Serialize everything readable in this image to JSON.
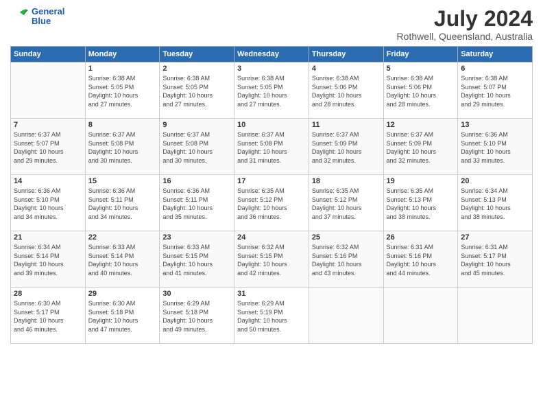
{
  "header": {
    "logo_line1": "General",
    "logo_line2": "Blue",
    "month_year": "July 2024",
    "location": "Rothwell, Queensland, Australia"
  },
  "days_of_week": [
    "Sunday",
    "Monday",
    "Tuesday",
    "Wednesday",
    "Thursday",
    "Friday",
    "Saturday"
  ],
  "weeks": [
    [
      {
        "num": "",
        "info": ""
      },
      {
        "num": "1",
        "info": "Sunrise: 6:38 AM\nSunset: 5:05 PM\nDaylight: 10 hours\nand 27 minutes."
      },
      {
        "num": "2",
        "info": "Sunrise: 6:38 AM\nSunset: 5:05 PM\nDaylight: 10 hours\nand 27 minutes."
      },
      {
        "num": "3",
        "info": "Sunrise: 6:38 AM\nSunset: 5:05 PM\nDaylight: 10 hours\nand 27 minutes."
      },
      {
        "num": "4",
        "info": "Sunrise: 6:38 AM\nSunset: 5:06 PM\nDaylight: 10 hours\nand 28 minutes."
      },
      {
        "num": "5",
        "info": "Sunrise: 6:38 AM\nSunset: 5:06 PM\nDaylight: 10 hours\nand 28 minutes."
      },
      {
        "num": "6",
        "info": "Sunrise: 6:38 AM\nSunset: 5:07 PM\nDaylight: 10 hours\nand 29 minutes."
      }
    ],
    [
      {
        "num": "7",
        "info": "Sunrise: 6:37 AM\nSunset: 5:07 PM\nDaylight: 10 hours\nand 29 minutes."
      },
      {
        "num": "8",
        "info": "Sunrise: 6:37 AM\nSunset: 5:08 PM\nDaylight: 10 hours\nand 30 minutes."
      },
      {
        "num": "9",
        "info": "Sunrise: 6:37 AM\nSunset: 5:08 PM\nDaylight: 10 hours\nand 30 minutes."
      },
      {
        "num": "10",
        "info": "Sunrise: 6:37 AM\nSunset: 5:08 PM\nDaylight: 10 hours\nand 31 minutes."
      },
      {
        "num": "11",
        "info": "Sunrise: 6:37 AM\nSunset: 5:09 PM\nDaylight: 10 hours\nand 32 minutes."
      },
      {
        "num": "12",
        "info": "Sunrise: 6:37 AM\nSunset: 5:09 PM\nDaylight: 10 hours\nand 32 minutes."
      },
      {
        "num": "13",
        "info": "Sunrise: 6:36 AM\nSunset: 5:10 PM\nDaylight: 10 hours\nand 33 minutes."
      }
    ],
    [
      {
        "num": "14",
        "info": "Sunrise: 6:36 AM\nSunset: 5:10 PM\nDaylight: 10 hours\nand 34 minutes."
      },
      {
        "num": "15",
        "info": "Sunrise: 6:36 AM\nSunset: 5:11 PM\nDaylight: 10 hours\nand 34 minutes."
      },
      {
        "num": "16",
        "info": "Sunrise: 6:36 AM\nSunset: 5:11 PM\nDaylight: 10 hours\nand 35 minutes."
      },
      {
        "num": "17",
        "info": "Sunrise: 6:35 AM\nSunset: 5:12 PM\nDaylight: 10 hours\nand 36 minutes."
      },
      {
        "num": "18",
        "info": "Sunrise: 6:35 AM\nSunset: 5:12 PM\nDaylight: 10 hours\nand 37 minutes."
      },
      {
        "num": "19",
        "info": "Sunrise: 6:35 AM\nSunset: 5:13 PM\nDaylight: 10 hours\nand 38 minutes."
      },
      {
        "num": "20",
        "info": "Sunrise: 6:34 AM\nSunset: 5:13 PM\nDaylight: 10 hours\nand 38 minutes."
      }
    ],
    [
      {
        "num": "21",
        "info": "Sunrise: 6:34 AM\nSunset: 5:14 PM\nDaylight: 10 hours\nand 39 minutes."
      },
      {
        "num": "22",
        "info": "Sunrise: 6:33 AM\nSunset: 5:14 PM\nDaylight: 10 hours\nand 40 minutes."
      },
      {
        "num": "23",
        "info": "Sunrise: 6:33 AM\nSunset: 5:15 PM\nDaylight: 10 hours\nand 41 minutes."
      },
      {
        "num": "24",
        "info": "Sunrise: 6:32 AM\nSunset: 5:15 PM\nDaylight: 10 hours\nand 42 minutes."
      },
      {
        "num": "25",
        "info": "Sunrise: 6:32 AM\nSunset: 5:16 PM\nDaylight: 10 hours\nand 43 minutes."
      },
      {
        "num": "26",
        "info": "Sunrise: 6:31 AM\nSunset: 5:16 PM\nDaylight: 10 hours\nand 44 minutes."
      },
      {
        "num": "27",
        "info": "Sunrise: 6:31 AM\nSunset: 5:17 PM\nDaylight: 10 hours\nand 45 minutes."
      }
    ],
    [
      {
        "num": "28",
        "info": "Sunrise: 6:30 AM\nSunset: 5:17 PM\nDaylight: 10 hours\nand 46 minutes."
      },
      {
        "num": "29",
        "info": "Sunrise: 6:30 AM\nSunset: 5:18 PM\nDaylight: 10 hours\nand 47 minutes."
      },
      {
        "num": "30",
        "info": "Sunrise: 6:29 AM\nSunset: 5:18 PM\nDaylight: 10 hours\nand 49 minutes."
      },
      {
        "num": "31",
        "info": "Sunrise: 6:29 AM\nSunset: 5:19 PM\nDaylight: 10 hours\nand 50 minutes."
      },
      {
        "num": "",
        "info": ""
      },
      {
        "num": "",
        "info": ""
      },
      {
        "num": "",
        "info": ""
      }
    ]
  ]
}
